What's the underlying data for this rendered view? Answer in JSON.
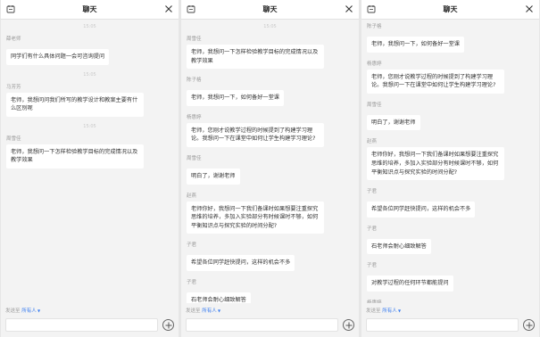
{
  "panels": [
    {
      "title": "聊天",
      "messages": [
        {
          "kind": "time",
          "text": "15:05"
        },
        {
          "kind": "msg",
          "sender": "薛老师",
          "text": "同学们有什么具体问题一会可咨询提问"
        },
        {
          "kind": "time",
          "text": "15:05"
        },
        {
          "kind": "msg",
          "sender": "马芳芳",
          "text": "老师，我想问问我们所写的教学设计和教案主要有什么区别呢"
        },
        {
          "kind": "time",
          "text": "15:05"
        },
        {
          "kind": "msg",
          "sender": "周雪佳",
          "text": "老师，我想问一下怎样检验教学目标的完成情况以及教学效果"
        }
      ],
      "send_to_label": "发送至",
      "send_to_target": "所有人"
    },
    {
      "title": "聊天",
      "messages": [
        {
          "kind": "time",
          "text": "15:05"
        },
        {
          "kind": "msg",
          "sender": "周雪佳",
          "text": "老师，我想问一下怎样检验教学目标的完成情况以及教学效果"
        },
        {
          "kind": "msg",
          "sender": "陈子格",
          "text": "老师，我想问一下，如何备好一堂课"
        },
        {
          "kind": "msg",
          "sender": "杨惠婷",
          "text": "老师，您刚才说教学过程的时候提到了构建学习理论。我想问一下在课堂中如何让学生构建学习理论?"
        },
        {
          "kind": "msg",
          "sender": "周雪佳",
          "text": "明白了，谢谢老师"
        },
        {
          "kind": "msg",
          "sender": "赵燕",
          "text": "老师你好，我想问一下我们备课时如果想要注重探究思维的培养，多加入实验部分有时候课时不够，如何平衡知识点与探究实验的时间分配?"
        },
        {
          "kind": "msg",
          "sender": "子君",
          "text": "希望各位同学赶快提问，这样的机会不多"
        },
        {
          "kind": "msg",
          "sender": "子君",
          "text": "石老师会耐心细致解答"
        }
      ],
      "send_to_label": "发送至",
      "send_to_target": "所有人"
    },
    {
      "title": "聊天",
      "messages": [
        {
          "kind": "msg",
          "sender": "陈子格",
          "text": "老师，我想问一下，如何备好一堂课"
        },
        {
          "kind": "msg",
          "sender": "杨惠婷",
          "text": "老师，您刚才说教学过程的时候提到了构建学习理论。我想问一下在课堂中如何让学生构建学习理论?"
        },
        {
          "kind": "msg",
          "sender": "周雪佳",
          "text": "明白了，谢谢老师"
        },
        {
          "kind": "msg",
          "sender": "赵燕",
          "text": "老师你好，我想问一下我们备课时如果想要注重探究思维的培养，多加入实验部分有时候课时不够，如何平衡知识点与探究实验的时间分配?"
        },
        {
          "kind": "msg",
          "sender": "子君",
          "text": "希望各位同学赶快提问，这样的机会不多"
        },
        {
          "kind": "msg",
          "sender": "子君",
          "text": "石老师会耐心细致解答"
        },
        {
          "kind": "msg",
          "sender": "子君",
          "text": "对教学过程的任何环节都能提问"
        },
        {
          "kind": "msg",
          "sender": "杨惠婷",
          "text": "好的，谢谢老师，是我的理解有问题"
        }
      ],
      "send_to_label": "发送至",
      "send_to_target": "所有人"
    }
  ]
}
